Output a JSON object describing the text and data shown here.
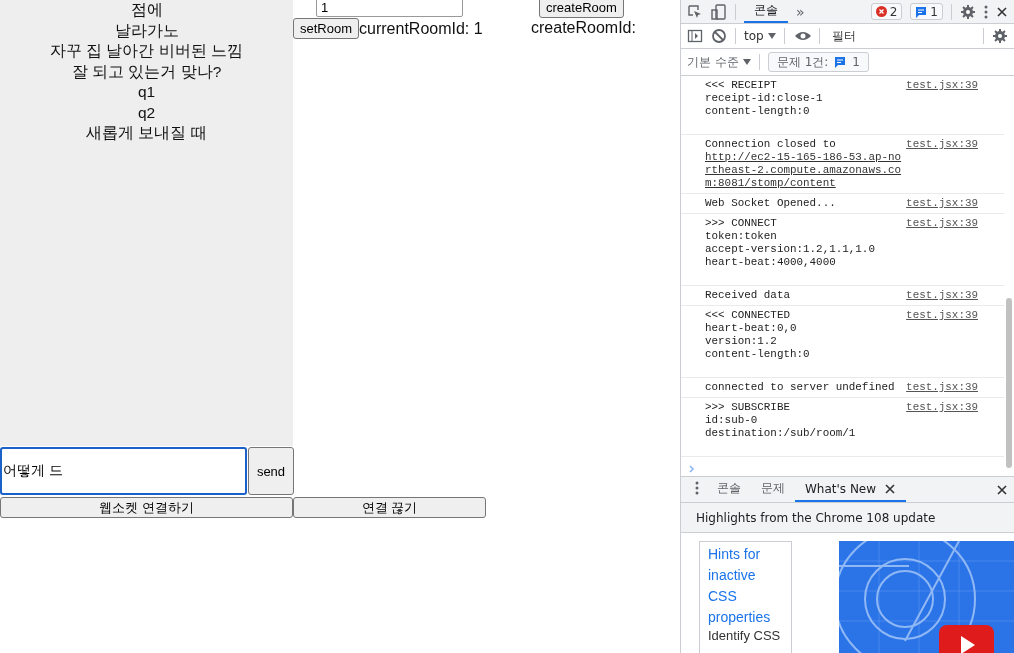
{
  "chat": {
    "messages": [
      "점에",
      "날라가노",
      "자꾸 집 날아간 비버된 느낌",
      "잘 되고 있는거 맞나?",
      "q1",
      "q2",
      "새롭게 보내질 때"
    ]
  },
  "room": {
    "room_input": {
      "value": "1"
    },
    "create_room_button": "createRoom",
    "set_room_button": "setRoom",
    "current_room_label": "currentRoomId: 1",
    "create_room_label": "createRoomId:"
  },
  "composer": {
    "value": "어떻게 드",
    "send_button": "send"
  },
  "connect_button": "웹소켓 연결하기",
  "disconnect_button": "연결 끊기",
  "devtools": {
    "tabs": [
      {
        "label": "콘솔",
        "selected": true
      }
    ],
    "more": "»",
    "error_count": "2",
    "message_count": "1",
    "context": "top",
    "filter": {
      "placeholder": "필터"
    },
    "level": "기본 수준",
    "issues": {
      "label": "문제 1건:",
      "count": "1"
    },
    "log": [
      {
        "lines": [
          "<<< RECEIPT",
          "receipt-id:close-1",
          "content-length:0"
        ],
        "source": "test.jsx:39"
      },
      {
        "lines": [
          "Connection closed to "
        ],
        "link": "http://ec2-15-165-186-53.ap-northeast-2.compute.amazonaws.com:8081/stomp/content",
        "source": "test.jsx:39"
      },
      {
        "lines": [
          "Web Socket Opened..."
        ],
        "source": "test.jsx:39"
      },
      {
        "lines": [
          ">>> CONNECT",
          "token:token",
          "accept-version:1.2,1.1,1.0",
          "heart-beat:4000,4000"
        ],
        "source": "test.jsx:39"
      },
      {
        "lines": [
          "Received data"
        ],
        "source": "test.jsx:39"
      },
      {
        "lines": [
          "<<< CONNECTED",
          "heart-beat:0,0",
          "version:1.2",
          "content-length:0"
        ],
        "source": "test.jsx:39"
      },
      {
        "lines": [
          "connected to server undefined"
        ],
        "source": "test.jsx:39"
      },
      {
        "lines": [
          ">>> SUBSCRIBE",
          "id:sub-0",
          "destination:/sub/room/1"
        ],
        "source": "test.jsx:39"
      }
    ],
    "drawer": {
      "tabs": [
        {
          "label": "콘솔",
          "selected": false
        },
        {
          "label": "문제",
          "selected": false
        },
        {
          "label": "What's New",
          "selected": true
        }
      ],
      "banner": "Highlights from the Chrome 108 update",
      "card": {
        "title": "Hints for inactive CSS properties",
        "text": "Identify CSS"
      }
    }
  }
}
